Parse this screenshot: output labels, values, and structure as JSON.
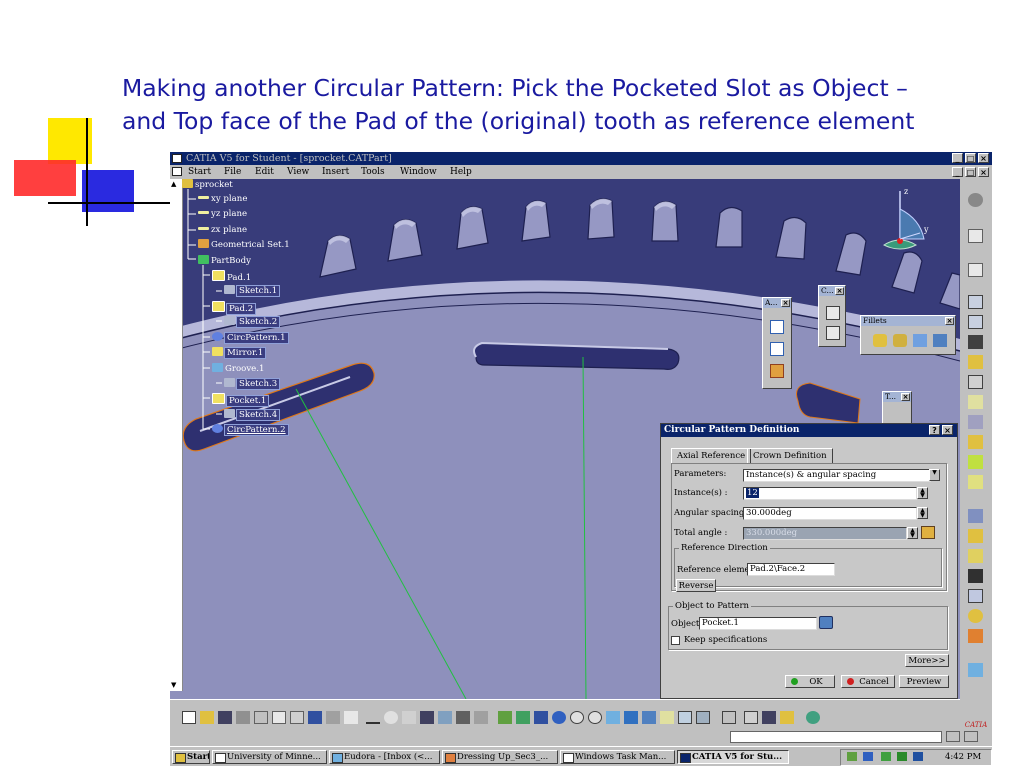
{
  "slide": {
    "title_line1": "Making another Circular Pattern: Pick the Pocketed Slot as Object –",
    "title_line2": "and Top face of the Pad of the (original) tooth as reference element"
  },
  "window": {
    "title": "CATIA V5 for Student - [sprocket.CATPart]",
    "min": "_",
    "max": "□",
    "close": "×"
  },
  "menu": [
    "Start",
    "File",
    "Edit",
    "View",
    "Insert",
    "Tools",
    "Window",
    "Help"
  ],
  "tree": [
    {
      "label": "sprocket",
      "icon": "part-icon",
      "sel": false
    },
    {
      "label": "xy plane",
      "icon": "plane-icon",
      "sel": false
    },
    {
      "label": "yz plane",
      "icon": "plane-icon",
      "sel": false
    },
    {
      "label": "zx plane",
      "icon": "plane-icon",
      "sel": false
    },
    {
      "label": "Geometrical Set.1",
      "icon": "geoset-icon",
      "sel": false
    },
    {
      "label": "PartBody",
      "icon": "body-icon",
      "sel": false
    },
    {
      "label": "Pad.1",
      "icon": "pad-icon",
      "sel": false
    },
    {
      "label": "Sketch.1",
      "icon": "sketch-icon",
      "sel": true
    },
    {
      "label": "Pad.2",
      "icon": "pad-icon",
      "sel": true
    },
    {
      "label": "Sketch.2",
      "icon": "sketch-icon",
      "sel": true
    },
    {
      "label": "CircPattern.1",
      "icon": "circpattern-icon",
      "sel": true
    },
    {
      "label": "Mirror.1",
      "icon": "mirror-icon",
      "sel": true
    },
    {
      "label": "Groove.1",
      "icon": "groove-icon",
      "sel": false
    },
    {
      "label": "Sketch.3",
      "icon": "sketch-icon",
      "sel": true
    },
    {
      "label": "Pocket.1",
      "icon": "pocket-icon",
      "sel": true
    },
    {
      "label": "Sketch.4",
      "icon": "sketch-icon",
      "sel": true
    },
    {
      "label": "CircPattern.2",
      "icon": "circpattern-icon",
      "sel": true
    }
  ],
  "compass": {
    "z": "z",
    "y": "y"
  },
  "panels": {
    "a": "A...",
    "c": "C...",
    "fillets": "Fillets",
    "t": "T..."
  },
  "dialog": {
    "title": "Circular Pattern Definition",
    "help_btn": "?",
    "close_btn": "×",
    "tabs": [
      "Axial Reference",
      "Crown Definition"
    ],
    "parameters_label": "Parameters:",
    "parameters_value": "Instance(s) & angular spacing",
    "instances_label": "Instance(s) :",
    "instances_value": "12",
    "angular_spacing_label": "Angular spacing :",
    "angular_spacing_value": "30.000deg",
    "total_angle_label": "Total angle :",
    "total_angle_value": "330.000deg",
    "ref_dir_group": "Reference Direction",
    "ref_element_label": "Reference element:",
    "ref_element_value": "Pad.2\\Face.2",
    "reverse_btn": "Reverse",
    "object_group": "Object to Pattern",
    "object_label": "Object:",
    "object_value": "Pocket.1",
    "keep_spec_label": "Keep specifications",
    "more_btn": "More>>",
    "ok_btn": "OK",
    "cancel_btn": "Cancel",
    "preview_btn": "Preview"
  },
  "statusbar": {
    "catia_logo": "CATIA"
  },
  "taskbar": {
    "start": "Start",
    "tasks": [
      {
        "label": "University of Minne...",
        "active": false
      },
      {
        "label": "Eudora - [Inbox (<...",
        "active": false
      },
      {
        "label": "Dressing Up_Sec3_...",
        "active": false
      },
      {
        "label": "Windows Task Man...",
        "active": false
      },
      {
        "label": "CATIA V5 for Stu...",
        "active": true
      }
    ],
    "clock": "4:42 PM"
  },
  "colors": {
    "title_blue": "#1a1aa0",
    "viewport_bg": "#383c7a",
    "gear_face": "#8e90bc",
    "gear_top": "#b6b8da",
    "window_title": "#0a246a",
    "highlight_orange": "#e07818"
  }
}
